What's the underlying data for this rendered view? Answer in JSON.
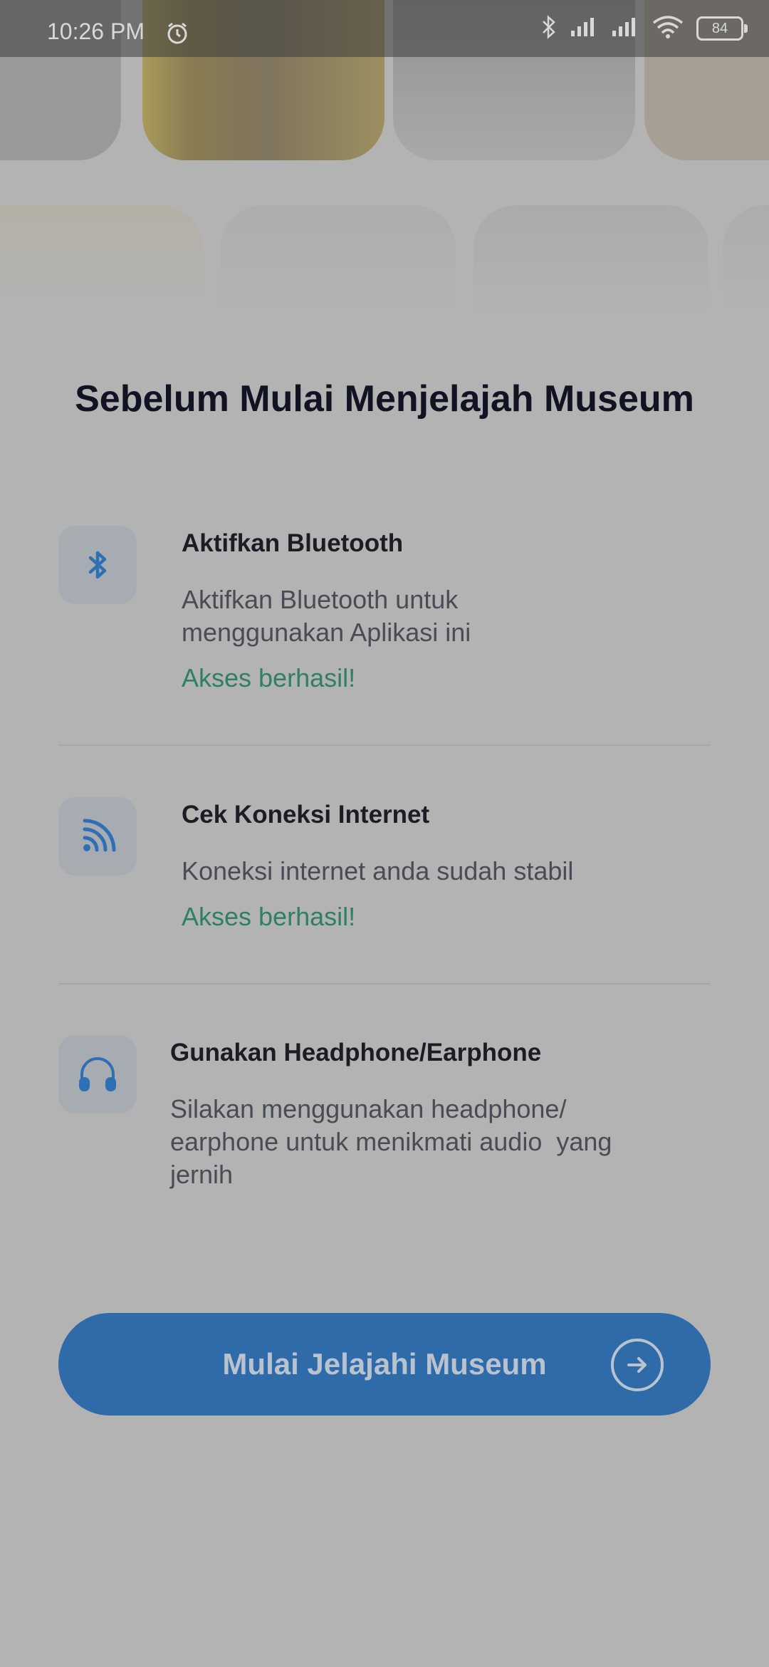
{
  "status_bar": {
    "time": "10:26 PM",
    "battery": "84"
  },
  "header": {
    "title": "Sebelum Mulai Menjelajah Museum"
  },
  "checklist": {
    "items": [
      {
        "title": "Aktifkan Bluetooth",
        "description_lines": [
          "Aktifkan Bluetooth untuk",
          "menggunakan Aplikasi ini"
        ],
        "status": "Akses berhasil!",
        "icon": "bluetooth-icon"
      },
      {
        "title": "Cek Koneksi Internet",
        "description_lines": [
          "Koneksi internet anda sudah stabil"
        ],
        "status": "Akses berhasil!",
        "icon": "wifi-signal-icon"
      },
      {
        "title": "Gunakan Headphone/Earphone",
        "description_lines": [
          "Silakan menggunakan headphone/",
          "earphone untuk menikmati audio  yang",
          "jernih"
        ],
        "icon": "headphones-icon"
      }
    ]
  },
  "cta": {
    "label": "Mulai Jelajahi Museum",
    "icon": "arrow-right-circle-icon"
  },
  "colors": {
    "accent": "#2e6ba8",
    "success": "#2e7f68",
    "title": "#111322"
  }
}
